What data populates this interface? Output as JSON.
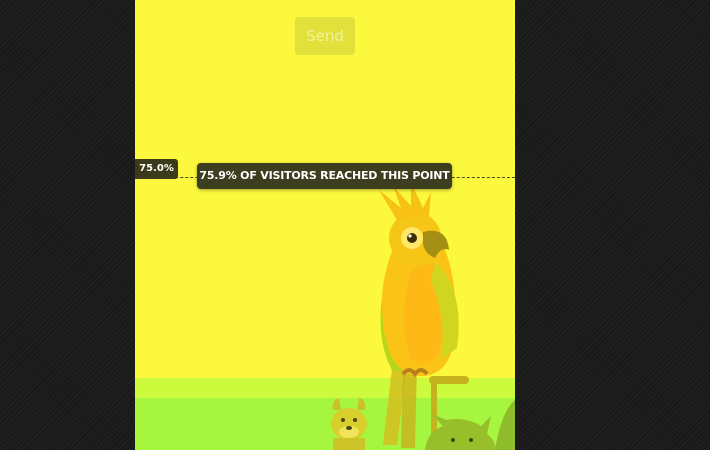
{
  "form": {
    "send_label": "Send"
  },
  "scroll_marker": {
    "depth_label": "75.0%",
    "tooltip": "75.9% OF VISITORS REACHED THIS POINT"
  },
  "colors": {
    "background": "#1c1c1c",
    "heat_yellow": "#fbf83d",
    "heat_yellow_green": "#ccfa3c",
    "heat_green": "#a6f63f",
    "marker_dark": "#3d3d1f"
  },
  "illustration": {
    "subjects": [
      "parrot-icon",
      "dog-icon",
      "cat-icon"
    ]
  }
}
